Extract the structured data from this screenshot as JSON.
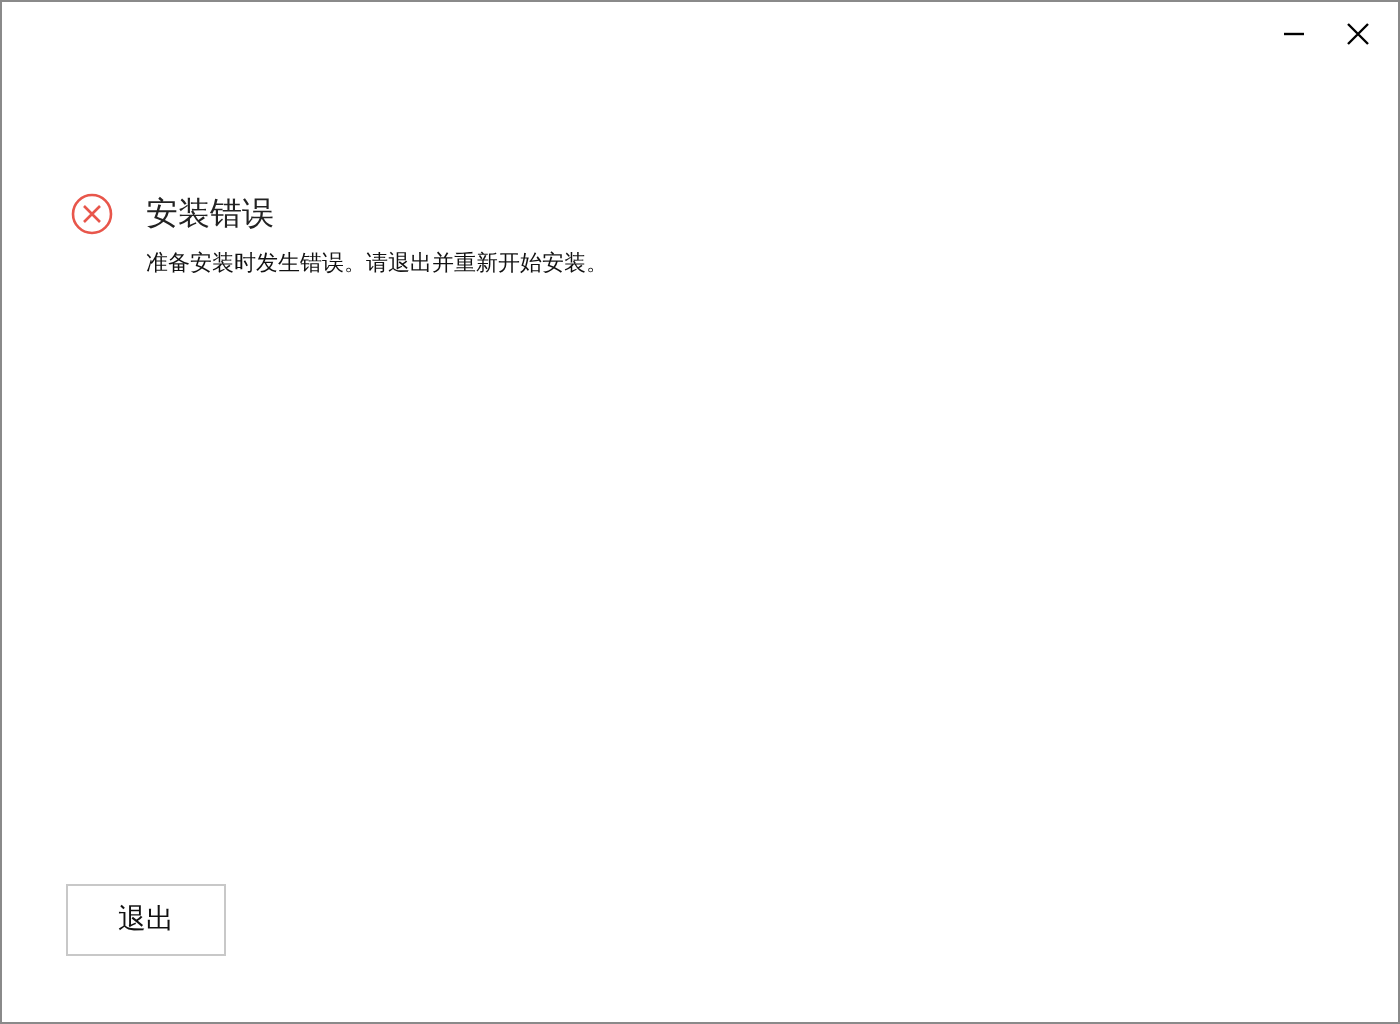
{
  "error": {
    "title": "安装错误",
    "message": "准备安装时发生错误。请退出并重新开始安装。"
  },
  "buttons": [
    {
      "label": "退出"
    }
  ]
}
